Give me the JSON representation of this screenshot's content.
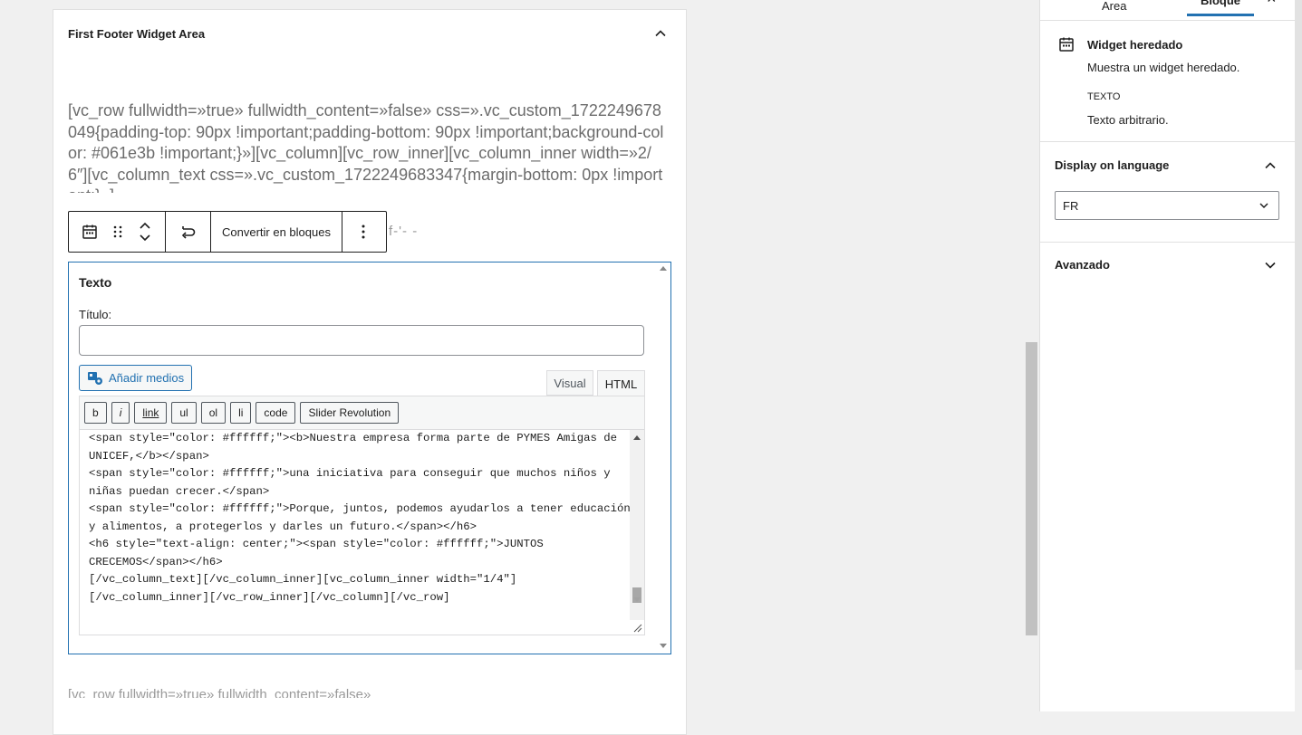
{
  "widget_area": {
    "title": "First Footer Widget Area",
    "preview_text": "[vc_row fullwidth=»true» fullwidth_content=»false» css=».vc_custom_1722249678049{padding-top: 90px !important;padding-bottom: 90px !important;background-color: #061e3b !important;}»][vc_column][vc_row_inner][vc_column_inner width=»2/6″][vc_column_text css=».vc_custom_1722249683347{margin-bottom: 0px !important;}»]",
    "preview_trail": "f-'- -",
    "preview_bottom": "[vc_row fullwidth=»true» fullwidth_content=»false»"
  },
  "toolbar": {
    "convert_label": "Convertir en bloques"
  },
  "text_widget": {
    "heading": "Texto",
    "title_label": "Título:",
    "title_value": "",
    "add_media_label": "Añadir medios",
    "tab_visual": "Visual",
    "tab_html": "HTML",
    "quicktags": [
      "b",
      "i",
      "link",
      "ul",
      "ol",
      "li",
      "code",
      "Slider Revolution"
    ],
    "code_content": "<span style=\"color: #ffffff;\"><b>Nuestra empresa forma parte de PYMES Amigas de\nUNICEF,</b></span>\n<span style=\"color: #ffffff;\">una iniciativa para conseguir que muchos niños y\nniñas puedan crecer.</span>\n<span style=\"color: #ffffff;\">Porque, juntos, podemos ayudarlos a tener educación\ny alimentos, a protegerlos y darles un futuro.</span></h6>\n<h6 style=\"text-align: center;\"><span style=\"color: #ffffff;\">JUNTOS\nCRECEMOS</span></h6>\n[/vc_column_text][/vc_column_inner][vc_column_inner width=\"1/4\"]\n[/vc_column_inner][/vc_row_inner][/vc_column][/vc_row]"
  },
  "sidebar": {
    "tab_area": "Area",
    "tab_block": "Bloque",
    "close_glyph": "×",
    "block_title": "Widget heredado",
    "block_desc": "Muestra un widget heredado.",
    "variation_label": "TEXTO",
    "variation_desc": "Texto arbitrario.",
    "language_section": "Display on language",
    "language_value": "FR",
    "advanced_section": "Avanzado"
  },
  "colors": {
    "accent": "#2271b1",
    "text": "#1e1e1e",
    "muted": "#6c6c6c"
  }
}
